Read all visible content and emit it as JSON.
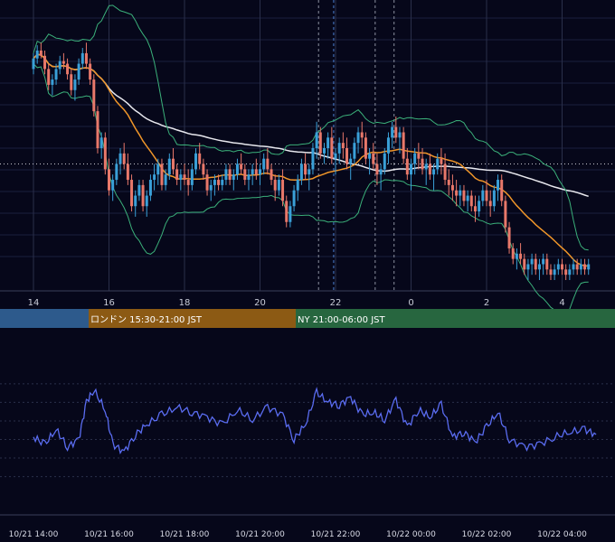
{
  "colors": {
    "background": "#06071a",
    "grid": "#1a1f3d",
    "candle_up": "#3aa0d8",
    "candle_down": "#e8786a",
    "bollinger": "#3bb07a",
    "ma_orange": "#f0962a",
    "ma_white": "#e8e8ee",
    "rsi_line": "#5a6cf0",
    "price_line": "#c8c8d0",
    "session_asia": "#2d5a8c",
    "session_london": "#8c5a14",
    "session_ny": "#27663f",
    "session_marker_grey": "#8a8f9e",
    "session_marker_blue": "#4a7fd0"
  },
  "chart_data": [
    {
      "type": "candlestick",
      "name": "price",
      "x_ticks": [
        "14",
        "16",
        "18",
        "20",
        "22",
        "0",
        "2",
        "4"
      ],
      "ylim": [
        0,
        100
      ],
      "reference_line": 44,
      "indicators": [
        "Bollinger Bands",
        "moving average (orange)",
        "moving average (white)"
      ],
      "candles": [
        [
          14.0,
          80,
          86,
          78,
          84
        ],
        [
          14.1,
          84,
          89,
          82,
          87
        ],
        [
          14.2,
          87,
          90,
          84,
          85
        ],
        [
          14.3,
          85,
          87,
          78,
          80
        ],
        [
          14.4,
          80,
          82,
          72,
          74
        ],
        [
          14.5,
          74,
          78,
          70,
          76
        ],
        [
          14.6,
          76,
          82,
          74,
          80
        ],
        [
          14.7,
          80,
          85,
          78,
          83
        ],
        [
          14.8,
          83,
          86,
          80,
          82
        ],
        [
          14.9,
          82,
          84,
          76,
          78
        ],
        [
          15.0,
          78,
          80,
          70,
          72
        ],
        [
          15.1,
          72,
          78,
          68,
          76
        ],
        [
          15.2,
          76,
          84,
          74,
          82
        ],
        [
          15.3,
          82,
          88,
          80,
          86
        ],
        [
          15.4,
          86,
          90,
          80,
          82
        ],
        [
          15.5,
          82,
          84,
          74,
          76
        ],
        [
          15.6,
          76,
          78,
          62,
          64
        ],
        [
          15.7,
          64,
          66,
          48,
          50
        ],
        [
          15.8,
          50,
          56,
          46,
          54
        ],
        [
          15.9,
          54,
          56,
          40,
          42
        ],
        [
          16.0,
          42,
          46,
          32,
          34
        ],
        [
          16.1,
          34,
          40,
          30,
          38
        ],
        [
          16.2,
          38,
          46,
          36,
          44
        ],
        [
          16.3,
          44,
          50,
          40,
          48
        ],
        [
          16.4,
          48,
          52,
          42,
          44
        ],
        [
          16.5,
          44,
          48,
          36,
          38
        ],
        [
          16.6,
          38,
          40,
          26,
          28
        ],
        [
          16.7,
          28,
          34,
          24,
          32
        ],
        [
          16.8,
          32,
          38,
          30,
          36
        ],
        [
          16.9,
          36,
          38,
          26,
          28
        ],
        [
          17.0,
          28,
          34,
          24,
          32
        ],
        [
          17.1,
          32,
          40,
          30,
          38
        ],
        [
          17.2,
          38,
          44,
          34,
          40
        ],
        [
          17.3,
          40,
          46,
          36,
          44
        ],
        [
          17.4,
          44,
          46,
          34,
          36
        ],
        [
          17.5,
          36,
          42,
          34,
          40
        ],
        [
          17.6,
          40,
          48,
          38,
          46
        ],
        [
          17.7,
          46,
          50,
          40,
          42
        ],
        [
          17.8,
          42,
          44,
          36,
          38
        ],
        [
          17.9,
          38,
          42,
          34,
          40
        ],
        [
          18.0,
          40,
          44,
          36,
          38
        ],
        [
          18.1,
          38,
          42,
          32,
          36
        ],
        [
          18.2,
          36,
          44,
          34,
          42
        ],
        [
          18.3,
          42,
          50,
          40,
          48
        ],
        [
          18.4,
          48,
          52,
          42,
          44
        ],
        [
          18.5,
          44,
          46,
          38,
          40
        ],
        [
          18.6,
          40,
          42,
          32,
          34
        ],
        [
          18.7,
          34,
          38,
          30,
          36
        ],
        [
          18.8,
          36,
          40,
          32,
          38
        ],
        [
          18.9,
          38,
          40,
          34,
          36
        ],
        [
          19.0,
          36,
          40,
          34,
          38
        ],
        [
          19.1,
          38,
          44,
          36,
          42
        ],
        [
          19.2,
          42,
          44,
          36,
          38
        ],
        [
          19.3,
          38,
          42,
          34,
          40
        ],
        [
          19.4,
          40,
          46,
          38,
          44
        ],
        [
          19.5,
          44,
          48,
          40,
          42
        ],
        [
          19.6,
          42,
          44,
          36,
          38
        ],
        [
          19.7,
          38,
          42,
          34,
          40
        ],
        [
          19.8,
          40,
          44,
          36,
          42
        ],
        [
          19.9,
          42,
          46,
          38,
          40
        ],
        [
          20.0,
          40,
          44,
          36,
          42
        ],
        [
          20.1,
          42,
          48,
          40,
          46
        ],
        [
          20.2,
          46,
          50,
          40,
          42
        ],
        [
          20.3,
          42,
          44,
          36,
          38
        ],
        [
          20.4,
          38,
          40,
          30,
          34
        ],
        [
          20.5,
          34,
          40,
          32,
          38
        ],
        [
          20.6,
          38,
          42,
          28,
          30
        ],
        [
          20.7,
          30,
          32,
          20,
          22
        ],
        [
          20.8,
          22,
          30,
          20,
          28
        ],
        [
          20.9,
          28,
          36,
          26,
          34
        ],
        [
          21.0,
          34,
          40,
          30,
          38
        ],
        [
          21.1,
          38,
          46,
          36,
          44
        ],
        [
          21.2,
          44,
          48,
          38,
          40
        ],
        [
          21.3,
          40,
          44,
          34,
          42
        ],
        [
          21.4,
          42,
          52,
          40,
          50
        ],
        [
          21.5,
          50,
          60,
          46,
          56
        ],
        [
          21.6,
          56,
          58,
          46,
          48
        ],
        [
          21.7,
          48,
          52,
          44,
          50
        ],
        [
          21.8,
          50,
          56,
          46,
          54
        ],
        [
          21.9,
          54,
          58,
          44,
          46
        ],
        [
          22.0,
          46,
          50,
          40,
          48
        ],
        [
          22.1,
          48,
          54,
          44,
          52
        ],
        [
          22.2,
          52,
          56,
          46,
          50
        ],
        [
          22.3,
          50,
          54,
          42,
          44
        ],
        [
          22.4,
          44,
          48,
          38,
          46
        ],
        [
          22.5,
          46,
          54,
          44,
          52
        ],
        [
          22.6,
          52,
          58,
          48,
          56
        ],
        [
          22.7,
          56,
          60,
          50,
          54
        ],
        [
          22.8,
          54,
          56,
          44,
          46
        ],
        [
          22.9,
          46,
          50,
          40,
          48
        ],
        [
          23.0,
          48,
          52,
          42,
          44
        ],
        [
          23.1,
          44,
          48,
          36,
          40
        ],
        [
          23.2,
          40,
          44,
          34,
          42
        ],
        [
          23.3,
          42,
          50,
          40,
          48
        ],
        [
          23.4,
          48,
          56,
          44,
          54
        ],
        [
          23.5,
          54,
          60,
          50,
          58
        ],
        [
          23.6,
          58,
          62,
          52,
          54
        ],
        [
          23.7,
          54,
          58,
          48,
          56
        ],
        [
          23.8,
          56,
          58,
          44,
          46
        ],
        [
          23.9,
          46,
          50,
          38,
          40
        ],
        [
          24.0,
          40,
          46,
          34,
          44
        ],
        [
          24.1,
          44,
          50,
          40,
          48
        ],
        [
          24.2,
          48,
          52,
          42,
          46
        ],
        [
          24.3,
          46,
          50,
          40,
          42
        ],
        [
          24.4,
          42,
          46,
          36,
          44
        ],
        [
          24.5,
          44,
          48,
          38,
          40
        ],
        [
          24.6,
          40,
          44,
          34,
          42
        ],
        [
          24.7,
          42,
          48,
          40,
          46
        ],
        [
          24.8,
          46,
          50,
          40,
          44
        ],
        [
          24.9,
          44,
          48,
          36,
          38
        ],
        [
          25.0,
          38,
          42,
          32,
          36
        ],
        [
          25.1,
          36,
          40,
          30,
          34
        ],
        [
          25.2,
          34,
          38,
          28,
          32
        ],
        [
          25.3,
          32,
          36,
          28,
          34
        ],
        [
          25.4,
          34,
          36,
          28,
          30
        ],
        [
          25.5,
          30,
          34,
          26,
          32
        ],
        [
          25.6,
          32,
          34,
          26,
          28
        ],
        [
          25.7,
          28,
          32,
          22,
          26
        ],
        [
          25.8,
          26,
          32,
          24,
          30
        ],
        [
          25.9,
          30,
          36,
          28,
          34
        ],
        [
          26.0,
          34,
          38,
          28,
          30
        ],
        [
          26.1,
          30,
          34,
          24,
          28
        ],
        [
          26.2,
          28,
          36,
          26,
          34
        ],
        [
          26.3,
          34,
          40,
          30,
          38
        ],
        [
          26.4,
          38,
          40,
          28,
          30
        ],
        [
          26.5,
          30,
          32,
          18,
          20
        ],
        [
          26.6,
          20,
          22,
          10,
          12
        ],
        [
          26.7,
          12,
          14,
          6,
          8
        ],
        [
          26.8,
          8,
          12,
          4,
          10
        ],
        [
          26.9,
          10,
          14,
          6,
          8
        ],
        [
          27.0,
          8,
          10,
          2,
          4
        ],
        [
          27.1,
          4,
          8,
          0,
          6
        ],
        [
          27.2,
          6,
          10,
          2,
          8
        ],
        [
          27.3,
          8,
          10,
          2,
          4
        ],
        [
          27.4,
          4,
          8,
          0,
          6
        ],
        [
          27.5,
          6,
          10,
          2,
          8
        ],
        [
          27.6,
          8,
          10,
          2,
          4
        ],
        [
          27.7,
          4,
          6,
          0,
          2
        ],
        [
          27.8,
          2,
          6,
          0,
          4
        ],
        [
          27.9,
          4,
          8,
          2,
          6
        ],
        [
          28.0,
          6,
          8,
          2,
          4
        ],
        [
          28.1,
          4,
          6,
          0,
          2
        ],
        [
          28.2,
          2,
          6,
          0,
          4
        ],
        [
          28.3,
          4,
          8,
          2,
          6
        ],
        [
          28.4,
          6,
          8,
          2,
          4
        ],
        [
          28.5,
          4,
          8,
          2,
          6
        ],
        [
          28.6,
          6,
          8,
          2,
          4
        ],
        [
          28.7,
          4,
          8,
          2,
          6
        ]
      ],
      "vertical_markers": [
        {
          "x": 21.55,
          "style": "grey-dashed"
        },
        {
          "x": 21.95,
          "style": "blue-dashed"
        },
        {
          "x": 23.05,
          "style": "grey-dashed"
        },
        {
          "x": 23.55,
          "style": "grey-dashed"
        }
      ]
    },
    {
      "type": "line",
      "name": "oscillator",
      "x_ticks": [
        "10/21 14:00",
        "10/21 16:00",
        "10/21 18:00",
        "10/21 20:00",
        "10/21 22:00",
        "10/22 00:00",
        "10/22 02:00",
        "10/22 04:00"
      ],
      "ylim": [
        0,
        100
      ],
      "y_gridlines": [
        20,
        35,
        50,
        65,
        80,
        95
      ],
      "x": [
        14.0,
        14.3,
        14.6,
        14.9,
        15.2,
        15.4,
        15.6,
        15.9,
        16.1,
        16.4,
        16.7,
        17.0,
        17.4,
        17.8,
        18.2,
        18.6,
        19.0,
        19.4,
        19.8,
        20.2,
        20.6,
        20.9,
        21.2,
        21.5,
        21.8,
        22.1,
        22.4,
        22.7,
        23.0,
        23.3,
        23.6,
        23.9,
        24.2,
        24.5,
        24.8,
        25.1,
        25.4,
        25.7,
        26.0,
        26.3,
        26.6,
        27.0,
        27.4,
        27.8,
        28.2,
        28.6,
        28.9
      ],
      "values": [
        52,
        46,
        58,
        44,
        50,
        80,
        90,
        74,
        46,
        40,
        54,
        62,
        70,
        76,
        72,
        68,
        62,
        74,
        66,
        76,
        70,
        50,
        62,
        88,
        80,
        78,
        84,
        70,
        72,
        66,
        82,
        60,
        74,
        68,
        78,
        52,
        56,
        48,
        60,
        72,
        50,
        44,
        46,
        52,
        56,
        58,
        54
      ]
    }
  ],
  "sessions": [
    {
      "label": "",
      "color_key": "session_asia"
    },
    {
      "label": "ロンドン 15:30-21:00 JST",
      "color_key": "session_london"
    },
    {
      "label": "NY 21:00-06:00 JST",
      "color_key": "session_ny"
    }
  ]
}
